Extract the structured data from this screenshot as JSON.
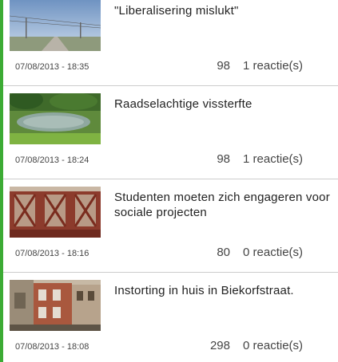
{
  "accent_color": "#3cab34",
  "articles": [
    {
      "title": "\"Liberalisering mislukt\"",
      "date": "07/08/2013 - 18:35",
      "views": "98",
      "reactions": "1 reactie(s)",
      "image": "road-landscape-photo"
    },
    {
      "title": "Raadselachtige vissterfte",
      "date": "07/08/2013 - 18:24",
      "views": "98",
      "reactions": "1 reactie(s)",
      "image": "pond-photo"
    },
    {
      "title": "Studenten moeten zich engageren voor sociale projecten",
      "date": "07/08/2013 - 18:16",
      "views": "80",
      "reactions": "0 reactie(s)",
      "image": "brick-building-photo"
    },
    {
      "title": "Instorting in huis in Biekorfstraat.",
      "date": "07/08/2013 - 18:08",
      "views": "298",
      "reactions": "0 reactie(s)",
      "image": "collapsed-house-photo"
    }
  ]
}
